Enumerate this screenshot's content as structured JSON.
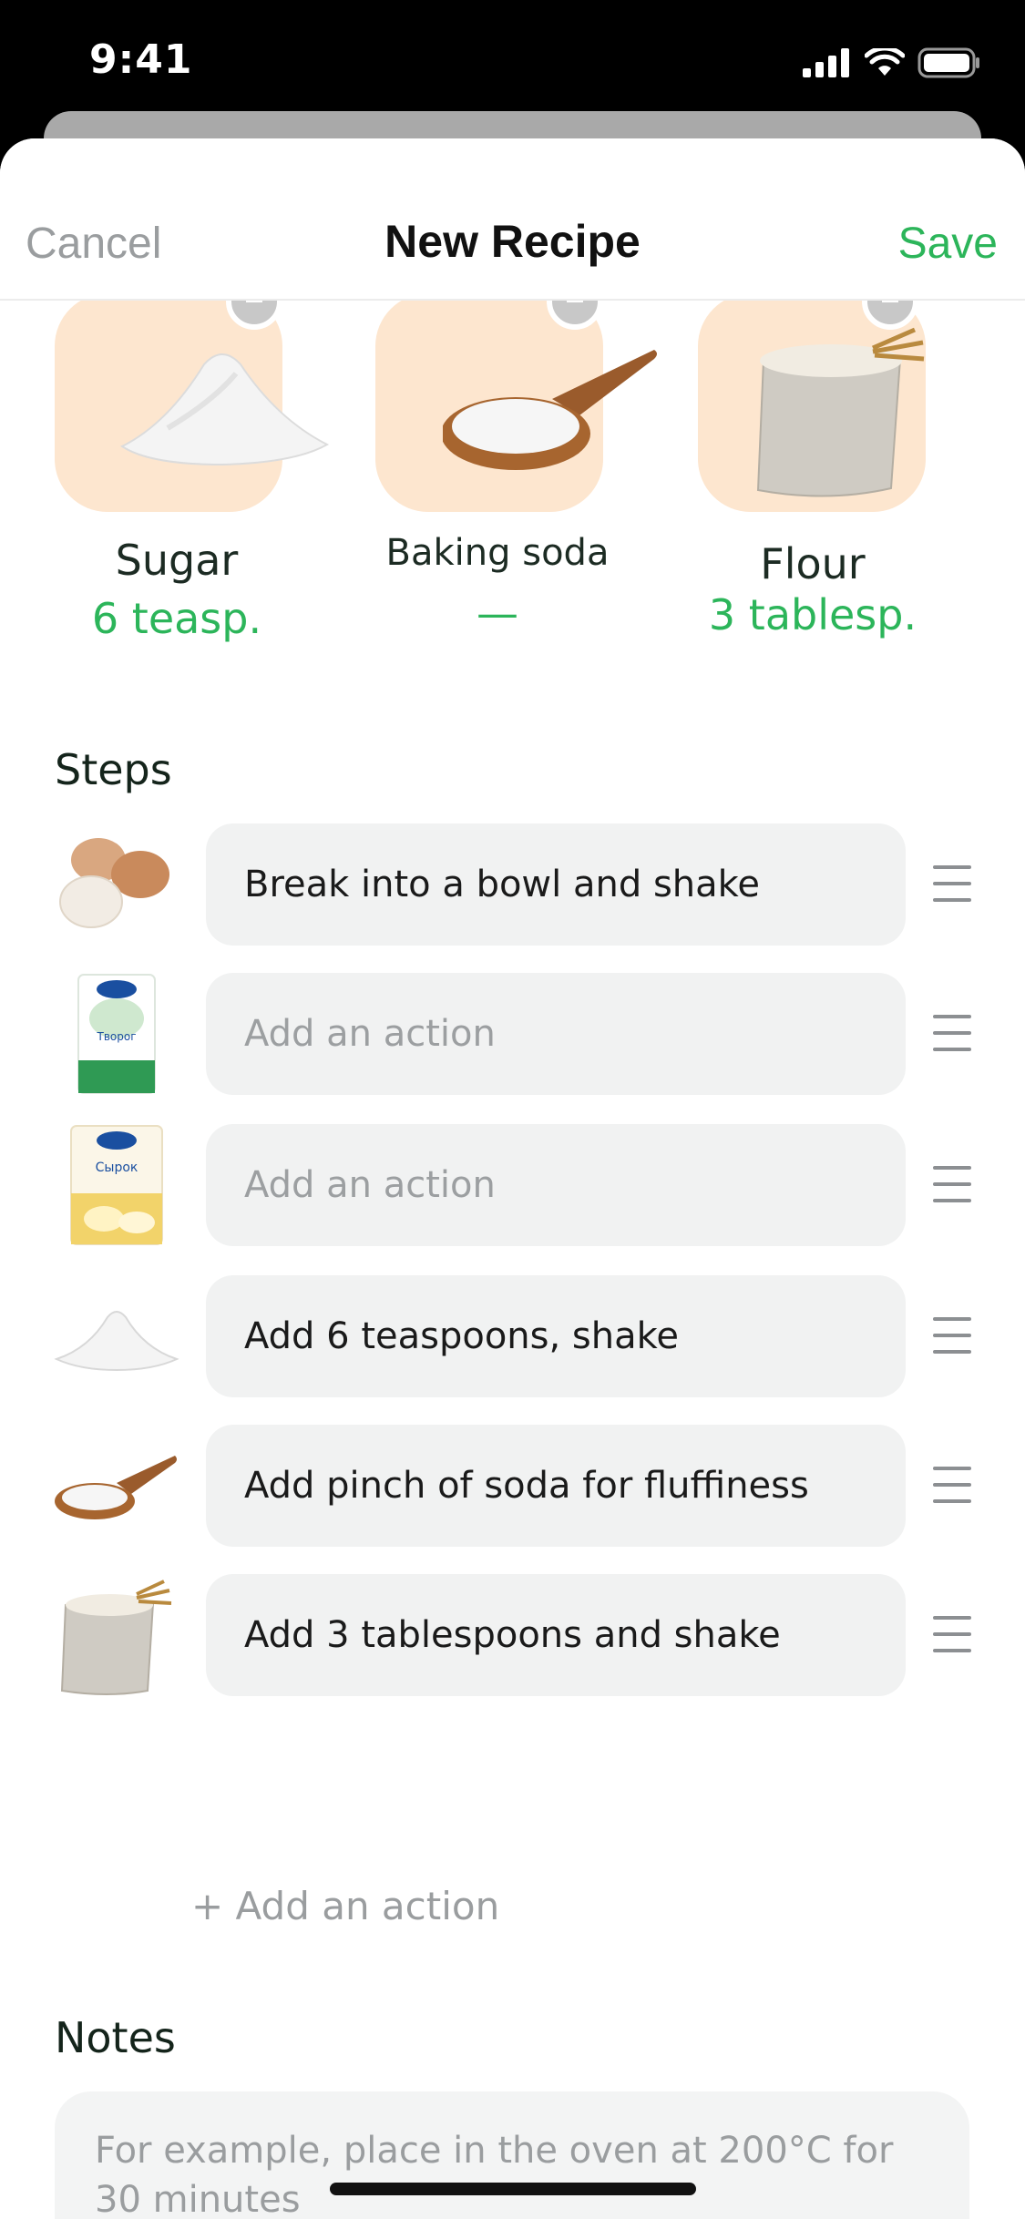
{
  "status": {
    "time": "9:41",
    "icons": [
      "signal-icon",
      "wifi-icon",
      "battery-icon"
    ]
  },
  "nav": {
    "cancel_label": "Cancel",
    "title": "New Recipe",
    "save_label": "Save"
  },
  "ingredients": [
    {
      "name": "Sugar",
      "amount": "6 teasp.",
      "image": "sugar-pile"
    },
    {
      "name": "Baking soda",
      "amount": "—",
      "image": "soda-spoon"
    },
    {
      "name": "Flour",
      "amount": "3 tablesp.",
      "image": "flour-sack"
    }
  ],
  "steps_title": "Steps",
  "steps": [
    {
      "text": "Break into a bowl and shake",
      "placeholder": false,
      "image": "eggs"
    },
    {
      "text": "Add an action",
      "placeholder": true,
      "image": "cottage-cheese-pack",
      "pack_label": "Творог"
    },
    {
      "text": "Add an action",
      "placeholder": true,
      "image": "cheese-curd-pack",
      "pack_label": "Сырок"
    },
    {
      "text": "Add 6 teaspoons, shake",
      "placeholder": false,
      "image": "sugar-pile"
    },
    {
      "text": "Add pinch of soda for fluffiness",
      "placeholder": false,
      "image": "soda-spoon"
    },
    {
      "text": "Add 3 tablespoons and shake",
      "placeholder": false,
      "image": "flour-sack"
    }
  ],
  "add_action_label": "+ Add an action",
  "notes_title": "Notes",
  "notes_placeholder": "For example, place in the oven at 200°C for 30 minutes",
  "colors": {
    "accent": "#2cb55a",
    "tile": "#fde6cf",
    "field": "#f1f2f2"
  }
}
